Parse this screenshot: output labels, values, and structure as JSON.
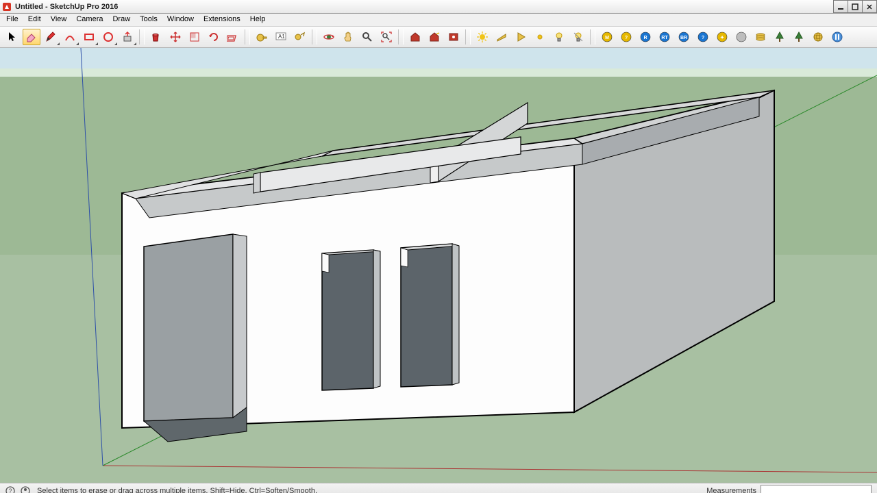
{
  "window": {
    "title": "Untitled - SketchUp Pro 2016"
  },
  "menus": [
    "File",
    "Edit",
    "View",
    "Camera",
    "Draw",
    "Tools",
    "Window",
    "Extensions",
    "Help"
  ],
  "tool_groups": [
    [
      {
        "name": "select-tool",
        "icon": "cursor",
        "active": false
      },
      {
        "name": "eraser-tool",
        "icon": "eraser",
        "active": true
      },
      {
        "name": "line-tool",
        "icon": "pencil",
        "dd": true
      },
      {
        "name": "arc-tool",
        "icon": "arc",
        "dd": true
      },
      {
        "name": "rectangle-tool",
        "icon": "rect",
        "dd": true
      },
      {
        "name": "circle-tool",
        "icon": "circle",
        "dd": true
      },
      {
        "name": "pushpull-tool",
        "icon": "pushpull",
        "dd": true
      }
    ],
    [
      {
        "name": "paint-bucket-tool",
        "icon": "bucket"
      },
      {
        "name": "move-tool",
        "icon": "move"
      },
      {
        "name": "scale-tool",
        "icon": "scale"
      },
      {
        "name": "rotate-tool",
        "icon": "rotate"
      },
      {
        "name": "offset-tool",
        "icon": "offset"
      }
    ],
    [
      {
        "name": "tape-measure-tool",
        "icon": "tape"
      },
      {
        "name": "text-tool",
        "icon": "text"
      },
      {
        "name": "dimension-tool",
        "icon": "dim"
      }
    ],
    [
      {
        "name": "orbit-tool",
        "icon": "orbit"
      },
      {
        "name": "pan-tool",
        "icon": "pan"
      },
      {
        "name": "zoom-tool",
        "icon": "zoom"
      },
      {
        "name": "zoom-extents-tool",
        "icon": "zoomext"
      }
    ],
    [
      {
        "name": "warehouse-tool",
        "icon": "wh1"
      },
      {
        "name": "warehouse2-tool",
        "icon": "wh2"
      },
      {
        "name": "extension-warehouse-tool",
        "icon": "wh3"
      }
    ],
    [
      {
        "name": "sun-tool",
        "icon": "sun"
      },
      {
        "name": "plane-tool",
        "icon": "plane"
      },
      {
        "name": "play-tool",
        "icon": "play"
      },
      {
        "name": "sun2-tool",
        "icon": "sun2"
      },
      {
        "name": "bulb-tool",
        "icon": "bulb"
      },
      {
        "name": "bulb2-tool",
        "icon": "bulb2"
      }
    ],
    [
      {
        "name": "badge-m",
        "icon": "badge",
        "label": "M",
        "color": "#e6b800"
      },
      {
        "name": "badge-qm",
        "icon": "badge",
        "label": "?",
        "color": "#e6b800"
      },
      {
        "name": "badge-r",
        "icon": "badge",
        "label": "R",
        "color": "#1a75d1"
      },
      {
        "name": "badge-rt",
        "icon": "badge",
        "label": "RT",
        "color": "#1a75d1"
      },
      {
        "name": "badge-br",
        "icon": "badge",
        "label": "BR",
        "color": "#1a75d1"
      },
      {
        "name": "badge-qb",
        "icon": "badge",
        "label": "?",
        "color": "#1a75d1"
      },
      {
        "name": "badge-gear",
        "icon": "badge",
        "label": "✦",
        "color": "#e6b800"
      },
      {
        "name": "badge-dot",
        "icon": "badge",
        "label": "",
        "color": "#bdbdbd"
      },
      {
        "name": "stack-tool",
        "icon": "stack"
      },
      {
        "name": "tree1-tool",
        "icon": "tree"
      },
      {
        "name": "tree2-tool",
        "icon": "tree"
      },
      {
        "name": "globe-tool",
        "icon": "globe"
      },
      {
        "name": "pause-tool",
        "icon": "pause"
      }
    ]
  ],
  "status": {
    "hint": "Select items to erase or drag across multiple items. Shift=Hide, Ctrl=Soften/Smooth.",
    "measurements_label": "Measurements"
  }
}
